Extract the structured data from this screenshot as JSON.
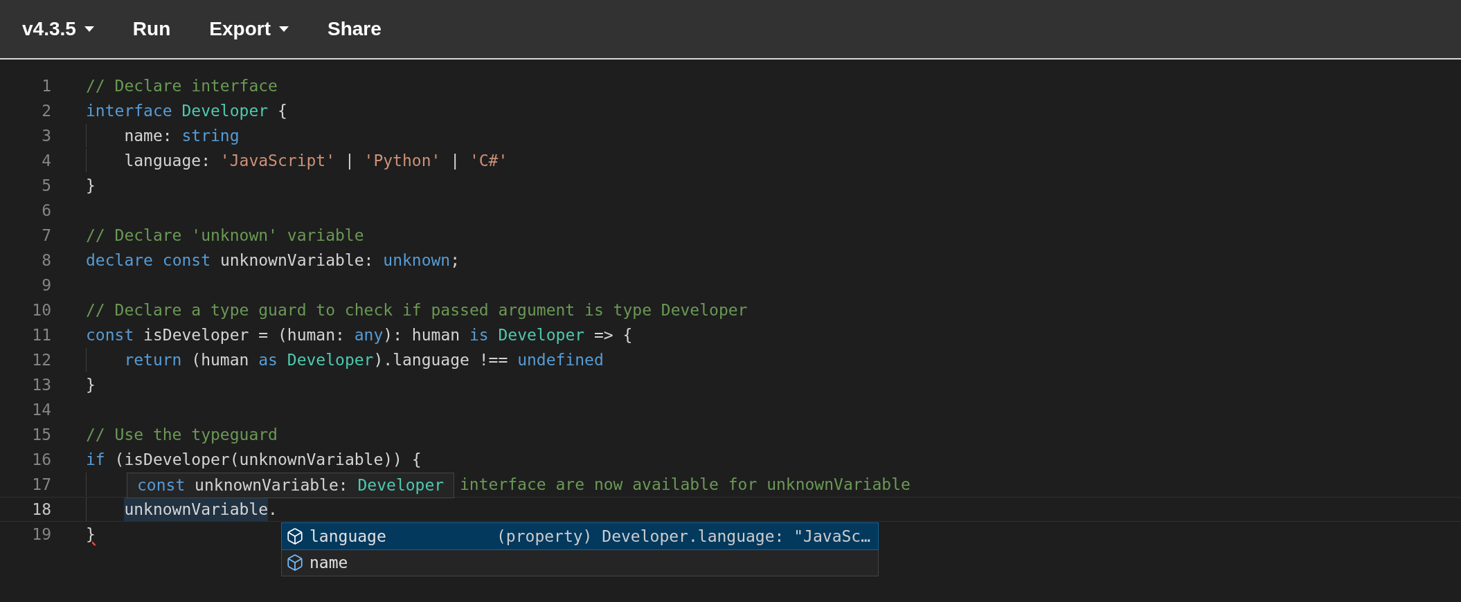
{
  "toolbar": {
    "items": [
      {
        "label": "v4.3.5",
        "has_menu": true
      },
      {
        "label": "Run",
        "has_menu": false
      },
      {
        "label": "Export",
        "has_menu": true
      },
      {
        "label": "Share",
        "has_menu": false
      }
    ]
  },
  "editor": {
    "lines": [
      {
        "number": "1",
        "current": false,
        "indented": false,
        "tokens": [
          {
            "text": "// Declare interface",
            "kind": "comment"
          }
        ]
      },
      {
        "number": "2",
        "current": false,
        "indented": false,
        "tokens": [
          {
            "text": "interface",
            "kind": "keyword"
          },
          {
            "text": " Developer",
            "kind": "type"
          },
          {
            "text": " {",
            "kind": "plain"
          }
        ]
      },
      {
        "number": "3",
        "current": false,
        "indented": true,
        "tokens": [
          {
            "text": "name: ",
            "kind": "plain"
          },
          {
            "text": "string",
            "kind": "keyword"
          }
        ]
      },
      {
        "number": "4",
        "current": false,
        "indented": true,
        "tokens": [
          {
            "text": "language: ",
            "kind": "plain"
          },
          {
            "text": "'JavaScript'",
            "kind": "string"
          },
          {
            "text": " | ",
            "kind": "plain"
          },
          {
            "text": "'Python'",
            "kind": "string"
          },
          {
            "text": " | ",
            "kind": "plain"
          },
          {
            "text": "'C#'",
            "kind": "string"
          }
        ]
      },
      {
        "number": "5",
        "current": false,
        "indented": false,
        "tokens": [
          {
            "text": "}",
            "kind": "plain"
          }
        ]
      },
      {
        "number": "6",
        "current": false,
        "indented": false
      },
      {
        "number": "7",
        "current": false,
        "indented": false,
        "tokens": [
          {
            "text": "// Declare 'unknown' variable",
            "kind": "comment"
          }
        ]
      },
      {
        "number": "8",
        "current": false,
        "indented": false,
        "tokens": [
          {
            "text": "declare",
            "kind": "keyword"
          },
          {
            "text": " const",
            "kind": "keyword"
          },
          {
            "text": " unknownVariable: ",
            "kind": "plain"
          },
          {
            "text": "unknown",
            "kind": "keyword"
          },
          {
            "text": ";",
            "kind": "plain"
          }
        ]
      },
      {
        "number": "9",
        "current": false,
        "indented": false
      },
      {
        "number": "10",
        "current": false,
        "indented": false,
        "tokens": [
          {
            "text": "// Declare a type guard to check if passed argument is type Developer",
            "kind": "comment"
          }
        ]
      },
      {
        "number": "11",
        "current": false,
        "indented": false,
        "tokens": [
          {
            "text": "const",
            "kind": "keyword"
          },
          {
            "text": " isDeveloper = (human: ",
            "kind": "plain"
          },
          {
            "text": "any",
            "kind": "keyword"
          },
          {
            "text": "): human ",
            "kind": "plain"
          },
          {
            "text": "is",
            "kind": "keyword"
          },
          {
            "text": " Developer",
            "kind": "type"
          },
          {
            "text": " => {",
            "kind": "plain"
          }
        ]
      },
      {
        "number": "12",
        "current": false,
        "indented": true,
        "tokens": [
          {
            "text": "return",
            "kind": "keyword"
          },
          {
            "text": " (human ",
            "kind": "plain"
          },
          {
            "text": "as",
            "kind": "keyword"
          },
          {
            "text": " Developer",
            "kind": "type"
          },
          {
            "text": ").language !== ",
            "kind": "plain"
          },
          {
            "text": "undefined",
            "kind": "keyword"
          }
        ]
      },
      {
        "number": "13",
        "current": false,
        "indented": false,
        "tokens": [
          {
            "text": "}",
            "kind": "plain"
          }
        ]
      },
      {
        "number": "14",
        "current": false,
        "indented": false
      },
      {
        "number": "15",
        "current": false,
        "indented": false,
        "tokens": [
          {
            "text": "// Use the typeguard",
            "kind": "comment"
          }
        ]
      },
      {
        "number": "16",
        "current": false,
        "indented": false,
        "tokens": [
          {
            "text": "if",
            "kind": "keyword"
          },
          {
            "text": " (isDeveloper(unknownVariable)) {",
            "kind": "plain"
          }
        ]
      },
      {
        "number": "17",
        "current": false,
        "indented": true,
        "tokens": [
          {
            "text": "interface are now available for unknownVariable",
            "kind": "comment-tail"
          }
        ]
      },
      {
        "number": "18",
        "current": true,
        "indented": true,
        "tokens": [
          {
            "text": "unknownVariable",
            "kind": "highlight"
          },
          {
            "text": ".",
            "kind": "plain"
          }
        ]
      },
      {
        "number": "19",
        "current": false,
        "indented": false,
        "tokens": [
          {
            "text": "}",
            "kind": "error"
          }
        ]
      }
    ]
  },
  "hover_tooltip": {
    "tokens": [
      {
        "text": "const",
        "kind": "keyword"
      },
      {
        "text": " unknownVariable: ",
        "kind": "plain"
      },
      {
        "text": "Developer",
        "kind": "type"
      }
    ]
  },
  "suggestions": [
    {
      "label": "language",
      "detail": "(property) Developer.language: \"JavaSc…",
      "selected": true
    },
    {
      "label": "name",
      "selected": false
    }
  ]
}
